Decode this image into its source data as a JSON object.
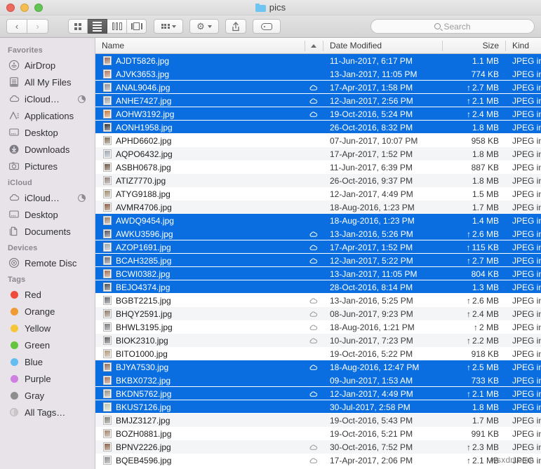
{
  "window": {
    "title": "pics",
    "folder_icon": "folder-icon",
    "traffic_lights": [
      "close-button",
      "minimize-button",
      "zoom-button"
    ]
  },
  "toolbar": {
    "back_label": "‹",
    "forward_label": "›",
    "view_modes": [
      {
        "name": "icon-view",
        "active": false
      },
      {
        "name": "list-view",
        "active": true
      },
      {
        "name": "column-view",
        "active": false
      },
      {
        "name": "coverflow-view",
        "active": false
      }
    ],
    "arrange_label": "arrange-icon",
    "action_label": "gear-icon",
    "share_label": "share-icon",
    "tag_label": "tag-icon",
    "search": {
      "placeholder": "Search",
      "value": ""
    }
  },
  "sidebar": {
    "sections": [
      {
        "title": "Favorites",
        "items": [
          {
            "label": "AirDrop",
            "icon": "airdrop-icon"
          },
          {
            "label": "All My Files",
            "icon": "all-my-files-icon"
          },
          {
            "label": "iCloud…",
            "icon": "icloud-icon",
            "badge": "pie-progress"
          },
          {
            "label": "Applications",
            "icon": "applications-icon"
          },
          {
            "label": "Desktop",
            "icon": "desktop-icon"
          },
          {
            "label": "Downloads",
            "icon": "downloads-icon"
          },
          {
            "label": "Pictures",
            "icon": "pictures-icon"
          }
        ]
      },
      {
        "title": "iCloud",
        "items": [
          {
            "label": "iCloud…",
            "icon": "icloud-icon",
            "badge": "pie-progress"
          },
          {
            "label": "Desktop",
            "icon": "desktop-icon"
          },
          {
            "label": "Documents",
            "icon": "documents-icon"
          }
        ]
      },
      {
        "title": "Devices",
        "items": [
          {
            "label": "Remote Disc",
            "icon": "remote-disc-icon"
          }
        ]
      },
      {
        "title": "Tags",
        "items": [
          {
            "label": "Red",
            "icon": "tag-dot",
            "color": "#ee4b3d"
          },
          {
            "label": "Orange",
            "icon": "tag-dot",
            "color": "#ef9a33"
          },
          {
            "label": "Yellow",
            "icon": "tag-dot",
            "color": "#f5c63a"
          },
          {
            "label": "Green",
            "icon": "tag-dot",
            "color": "#63c53d"
          },
          {
            "label": "Blue",
            "icon": "tag-dot",
            "color": "#63bdf0"
          },
          {
            "label": "Purple",
            "icon": "tag-dot",
            "color": "#cf7fe0"
          },
          {
            "label": "Gray",
            "icon": "tag-dot",
            "color": "#8e8e8e"
          },
          {
            "label": "All Tags…",
            "icon": "all-tags-icon"
          }
        ]
      }
    ]
  },
  "file_list": {
    "columns": [
      {
        "key": "name",
        "label": "Name",
        "sorted": "asc"
      },
      {
        "key": "date",
        "label": "Date Modified"
      },
      {
        "key": "size",
        "label": "Size"
      },
      {
        "key": "kind",
        "label": "Kind"
      }
    ],
    "sort_indicator": "sort-ascending-icon",
    "rows": [
      {
        "name": "AJDT5826.jpg",
        "cloud": false,
        "date": "11-Jun-2017, 6:17 PM",
        "size": "1.1 MB",
        "upload": false,
        "kind": "JPEG ima",
        "selected": true,
        "tint": "#9a6b58"
      },
      {
        "name": "AJVK3653.jpg",
        "cloud": false,
        "date": "13-Jan-2017, 11:05 PM",
        "size": "774 KB",
        "upload": false,
        "kind": "JPEG ima",
        "selected": true,
        "tint": "#b2795e"
      },
      {
        "name": "ANAL9046.jpg",
        "cloud": true,
        "date": "17-Apr-2017, 1:58 PM",
        "size": "2.7 MB",
        "upload": true,
        "kind": "JPEG ima",
        "selected": true,
        "tint": "#8c8f96"
      },
      {
        "name": "ANHE7427.jpg",
        "cloud": true,
        "date": "12-Jan-2017, 2:56 PM",
        "size": "2.1 MB",
        "upload": true,
        "kind": "JPEG ima",
        "selected": true,
        "tint": "#9a9aa2"
      },
      {
        "name": "AOHW3192.jpg",
        "cloud": true,
        "date": "19-Oct-2016, 5:24 PM",
        "size": "2.4 MB",
        "upload": true,
        "kind": "JPEG ima",
        "selected": true,
        "tint": "#c77a3c"
      },
      {
        "name": "AONH1958.jpg",
        "cloud": false,
        "date": "26-Oct-2016, 8:32 PM",
        "size": "1.8 MB",
        "upload": false,
        "kind": "JPEG ima",
        "selected": true,
        "tint": "#2f2f33"
      },
      {
        "name": "APHD6602.jpg",
        "cloud": false,
        "date": "07-Jun-2017, 10:07 PM",
        "size": "958 KB",
        "upload": false,
        "kind": "JPEG ima",
        "selected": false,
        "tint": "#7e6a55"
      },
      {
        "name": "AQPO6432.jpg",
        "cloud": false,
        "date": "17-Apr-2017, 1:52 PM",
        "size": "1.8 MB",
        "upload": false,
        "kind": "JPEG ima",
        "selected": false,
        "tint": "#9fa6b2"
      },
      {
        "name": "ASBH0678.jpg",
        "cloud": false,
        "date": "11-Jun-2017, 6:39 PM",
        "size": "887 KB",
        "upload": false,
        "kind": "JPEG ima",
        "selected": false,
        "tint": "#6b5442"
      },
      {
        "name": "ATIZ7770.jpg",
        "cloud": false,
        "date": "26-Oct-2016, 9:37 PM",
        "size": "1.8 MB",
        "upload": false,
        "kind": "JPEG ima",
        "selected": false,
        "tint": "#8d7f77"
      },
      {
        "name": "ATYG9188.jpg",
        "cloud": false,
        "date": "12-Jan-2017, 4:49 PM",
        "size": "1.5 MB",
        "upload": false,
        "kind": "JPEG ima",
        "selected": false,
        "tint": "#a08c6e"
      },
      {
        "name": "AVMR4706.jpg",
        "cloud": false,
        "date": "18-Aug-2016, 1:23 PM",
        "size": "1.7 MB",
        "upload": false,
        "kind": "JPEG ima",
        "selected": false,
        "tint": "#8a5b40"
      },
      {
        "name": "AWDQ9454.jpg",
        "cloud": false,
        "date": "18-Aug-2016, 1:23 PM",
        "size": "1.4 MB",
        "upload": false,
        "kind": "JPEG ima",
        "selected": true,
        "tint": "#9c7e66"
      },
      {
        "name": "AWKU3596.jpg",
        "cloud": true,
        "date": "13-Jan-2016, 5:26 PM",
        "size": "2.6 MB",
        "upload": true,
        "kind": "JPEG ima",
        "selected": true,
        "tint": "#55575e"
      },
      {
        "name": "AZOP1691.jpg",
        "cloud": true,
        "date": "17-Apr-2017, 1:52 PM",
        "size": "115 KB",
        "upload": true,
        "kind": "JPEG ima",
        "selected": true,
        "tint": "#9ba4ae"
      },
      {
        "name": "BCAH3285.jpg",
        "cloud": true,
        "date": "12-Jan-2017, 5:22 PM",
        "size": "2.7 MB",
        "upload": true,
        "kind": "JPEG ima",
        "selected": true,
        "tint": "#6d6e74"
      },
      {
        "name": "BCWI0382.jpg",
        "cloud": false,
        "date": "13-Jan-2017, 11:05 PM",
        "size": "804 KB",
        "upload": false,
        "kind": "JPEG ima",
        "selected": true,
        "tint": "#a4714f"
      },
      {
        "name": "BEJO4374.jpg",
        "cloud": false,
        "date": "28-Oct-2016, 8:14 PM",
        "size": "1.3 MB",
        "upload": false,
        "kind": "JPEG ima",
        "selected": true,
        "tint": "#4a4c52"
      },
      {
        "name": "BGBT2215.jpg",
        "cloud": true,
        "date": "13-Jan-2016, 5:25 PM",
        "size": "2.6 MB",
        "upload": true,
        "kind": "JPEG ima",
        "selected": false,
        "tint": "#636569"
      },
      {
        "name": "BHQY2591.jpg",
        "cloud": true,
        "date": "08-Jun-2017, 9:23 PM",
        "size": "2.4 MB",
        "upload": true,
        "kind": "JPEG ima",
        "selected": false,
        "tint": "#8e7a6c"
      },
      {
        "name": "BHWL3195.jpg",
        "cloud": true,
        "date": "18-Aug-2016, 1:21 PM",
        "size": "2 MB",
        "upload": true,
        "kind": "JPEG ima",
        "selected": false,
        "tint": "#77777d"
      },
      {
        "name": "BIOK2310.jpg",
        "cloud": true,
        "date": "10-Jun-2017, 7:23 PM",
        "size": "2.2 MB",
        "upload": true,
        "kind": "JPEG ima",
        "selected": false,
        "tint": "#5b5b61"
      },
      {
        "name": "BITO1000.jpg",
        "cloud": false,
        "date": "19-Oct-2016, 5:22 PM",
        "size": "918 KB",
        "upload": false,
        "kind": "JPEG ima",
        "selected": false,
        "tint": "#b0997a"
      },
      {
        "name": "BJYA7530.jpg",
        "cloud": true,
        "date": "18-Aug-2016, 12:47 PM",
        "size": "2.5 MB",
        "upload": true,
        "kind": "JPEG ima",
        "selected": true,
        "tint": "#8e6a54"
      },
      {
        "name": "BKBX0732.jpg",
        "cloud": false,
        "date": "09-Jun-2017, 1:53 AM",
        "size": "733 KB",
        "upload": false,
        "kind": "JPEG ima",
        "selected": true,
        "tint": "#a8715a"
      },
      {
        "name": "BKDN5762.jpg",
        "cloud": true,
        "date": "12-Jan-2017, 4:49 PM",
        "size": "2.1 MB",
        "upload": true,
        "kind": "JPEG ima",
        "selected": true,
        "tint": "#9a9286"
      },
      {
        "name": "BKUS7126.jpg",
        "cloud": false,
        "date": "30-Jul-2017, 2:58 PM",
        "size": "1.8 MB",
        "upload": false,
        "kind": "JPEG ima",
        "selected": true,
        "tint": "#b9c5ad"
      },
      {
        "name": "BMJZ3127.jpg",
        "cloud": false,
        "date": "19-Oct-2016, 5:43 PM",
        "size": "1.7 MB",
        "upload": false,
        "kind": "JPEG ima",
        "selected": false,
        "tint": "#7d7b72"
      },
      {
        "name": "BOZH0881.jpg",
        "cloud": false,
        "date": "19-Oct-2016, 5:21 PM",
        "size": "991 KB",
        "upload": false,
        "kind": "JPEG ima",
        "selected": false,
        "tint": "#a3846a"
      },
      {
        "name": "BPNV2226.jpg",
        "cloud": true,
        "date": "30-Oct-2016, 7:52 PM",
        "size": "2.3 MB",
        "upload": true,
        "kind": "JPEG ima",
        "selected": false,
        "tint": "#8b5f43"
      },
      {
        "name": "BQEB4596.jpg",
        "cloud": true,
        "date": "17-Apr-2017, 2:06 PM",
        "size": "2.1 MB",
        "upload": true,
        "kind": "JPEG ima",
        "selected": false,
        "tint": "#8a8a90"
      }
    ]
  },
  "watermark": {
    "text": "wsxdn.com"
  },
  "colors": {
    "selection": "#0a6ee1",
    "sidebar_bg": "#e8e3e8",
    "alt_row": "#f4f5f7"
  }
}
